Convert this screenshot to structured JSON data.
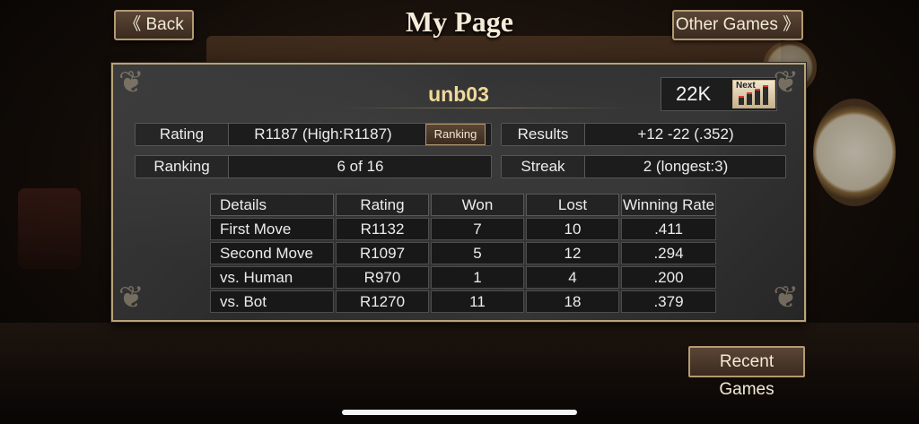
{
  "header": {
    "back_label": "《 Back",
    "title": "My Page",
    "other_games_label": "Other Games 》"
  },
  "profile": {
    "username": "unb03",
    "coins": "22K",
    "next_label": "Next"
  },
  "stats": {
    "rating_label": "Rating",
    "rating_value": "R1187 (High:R1187)",
    "ranking_button": "Ranking",
    "results_label": "Results",
    "results_value": "+12 -22 (.352)",
    "ranking_label": "Ranking",
    "ranking_value": "6 of 16",
    "streak_label": "Streak",
    "streak_value": "2 (longest:3)"
  },
  "details_table": {
    "headers": [
      "Details",
      "Rating",
      "Won",
      "Lost",
      "Winning Rate"
    ],
    "rows": [
      [
        "First Move",
        "R1132",
        "7",
        "10",
        ".411"
      ],
      [
        "Second Move",
        "R1097",
        "5",
        "12",
        ".294"
      ],
      [
        "vs. Human",
        "R970",
        "1",
        "4",
        ".200"
      ],
      [
        "vs. Bot",
        "R1270",
        "11",
        "18",
        ".379"
      ]
    ]
  },
  "footer": {
    "recent_games_label": "Recent Games"
  }
}
